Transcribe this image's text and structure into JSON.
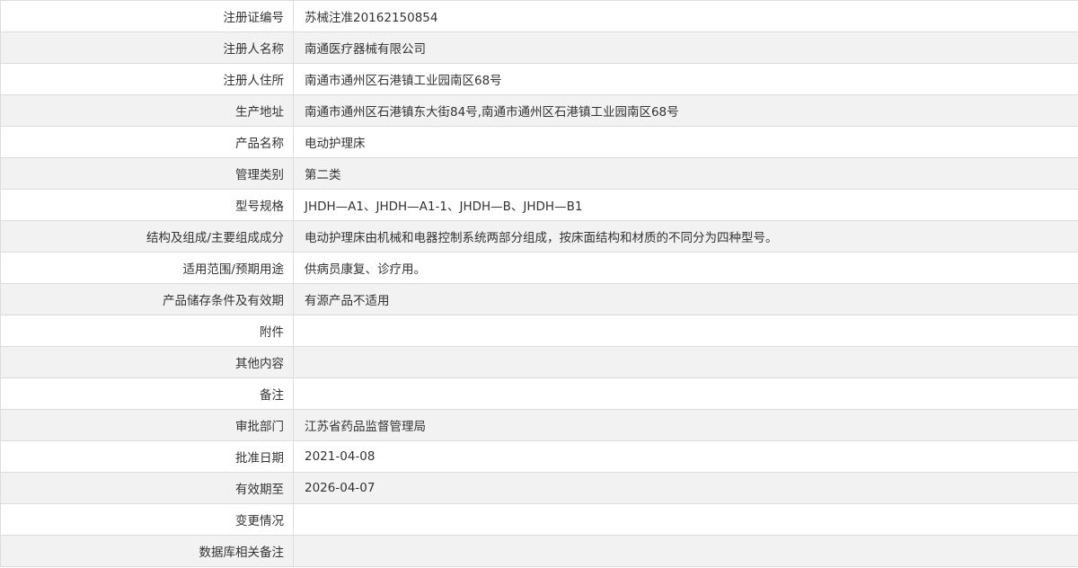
{
  "fields": [
    {
      "label": "注册证编号",
      "value": "苏械注准20162150854"
    },
    {
      "label": "注册人名称",
      "value": "南通医疗器械有限公司"
    },
    {
      "label": "注册人住所",
      "value": "南通市通州区石港镇工业园南区68号"
    },
    {
      "label": "生产地址",
      "value": "南通市通州区石港镇东大街84号,南通市通州区石港镇工业园南区68号"
    },
    {
      "label": "产品名称",
      "value": "电动护理床"
    },
    {
      "label": "管理类别",
      "value": "第二类"
    },
    {
      "label": "型号规格",
      "value": "JHDH—A1、JHDH—A1-1、JHDH—B、JHDH—B1"
    },
    {
      "label": "结构及组成/主要组成成分",
      "value": "电动护理床由机械和电器控制系统两部分组成，按床面结构和材质的不同分为四种型号。"
    },
    {
      "label": "适用范围/预期用途",
      "value": "供病员康复、诊疗用。"
    },
    {
      "label": "产品储存条件及有效期",
      "value": "有源产品不适用"
    },
    {
      "label": "附件",
      "value": ""
    },
    {
      "label": "其他内容",
      "value": ""
    },
    {
      "label": "备注",
      "value": ""
    },
    {
      "label": "审批部门",
      "value": "江苏省药品监督管理局"
    },
    {
      "label": "批准日期",
      "value": "2021-04-08"
    },
    {
      "label": "有效期至",
      "value": "2026-04-07"
    },
    {
      "label": "变更情况",
      "value": ""
    },
    {
      "label": "数据库相关备注",
      "value": ""
    }
  ]
}
